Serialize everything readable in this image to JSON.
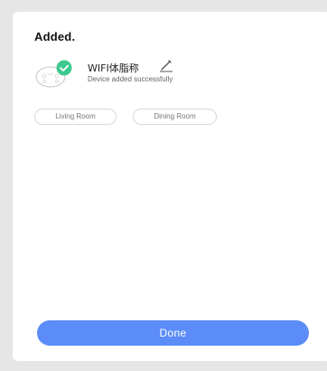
{
  "header": {
    "title": "Added."
  },
  "device": {
    "name": "WIFI体脂称",
    "status": "Device added successfully",
    "thumbnail_icon": "scale-device-icon",
    "badge_icon": "check-badge-icon",
    "edit_icon": "pencil-edit-icon"
  },
  "rooms": [
    {
      "label": "Living Room"
    },
    {
      "label": "Dining Room"
    }
  ],
  "footer": {
    "done_label": "Done"
  },
  "colors": {
    "accent": "#5b8cf7",
    "success": "#3ec98f",
    "background": "#e6e6e6",
    "card": "#ffffff"
  }
}
